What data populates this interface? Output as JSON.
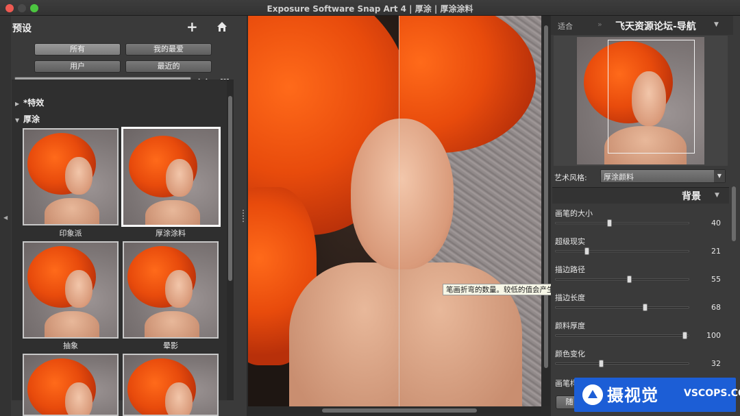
{
  "window": {
    "title": "Exposure Software Snap Art 4 | 厚涂 | 厚涂涂料"
  },
  "left_panel": {
    "title": "预设",
    "filters": [
      "所有",
      "我的最爱",
      "用户",
      "最近的"
    ],
    "search": {
      "value": "",
      "placeholder": ""
    },
    "groups": [
      {
        "name": "*特效",
        "expanded": false
      },
      {
        "name": "厚涂",
        "expanded": true
      }
    ],
    "presets": [
      {
        "label": "印象派",
        "selected": false
      },
      {
        "label": "厚涂涂料",
        "selected": true
      },
      {
        "label": "抽象",
        "selected": false
      },
      {
        "label": "晕影",
        "selected": false
      },
      {
        "label": "",
        "selected": false
      },
      {
        "label": "",
        "selected": false
      }
    ]
  },
  "canvas": {
    "tooltip": "笔画折弯的数量。较低的值会产生直 (竖定) 笔画。"
  },
  "navigator": {
    "fit_label": "适合",
    "title": "飞天资源论坛-导航"
  },
  "style": {
    "label": "艺术风格:",
    "value": "厚涂颜料"
  },
  "section": {
    "title": "背景"
  },
  "sliders": [
    {
      "label": "画笔的大小",
      "value": 40,
      "pos": 0.4
    },
    {
      "label": "超级现实",
      "value": 21,
      "pos": 0.23
    },
    {
      "label": "描边路径",
      "value": 55,
      "pos": 0.55
    },
    {
      "label": "描边长度",
      "value": 68,
      "pos": 0.67
    },
    {
      "label": "颜料厚度",
      "value": 100,
      "pos": 0.97
    },
    {
      "label": "颜色变化",
      "value": 32,
      "pos": 0.34
    },
    {
      "label": "画笔样",
      "value": null,
      "pos": null
    }
  ],
  "bottom_button": {
    "label": "随"
  },
  "watermark": {
    "brand": "摄视觉",
    "url": "VSCOPS.COM"
  }
}
